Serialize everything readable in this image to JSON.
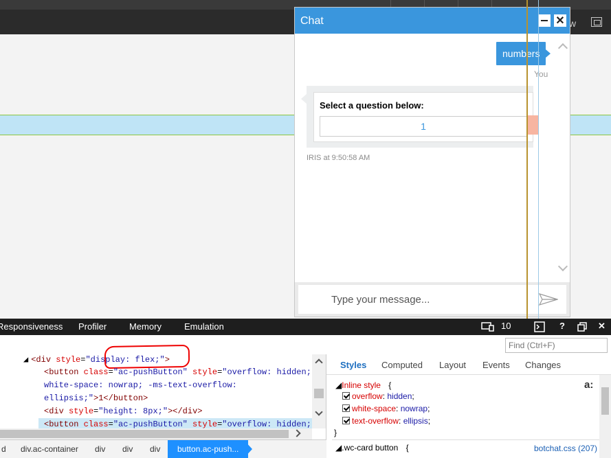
{
  "browser": {
    "toolbar_letter": "w",
    "fit_icon": "fit-to-window-icon"
  },
  "chat": {
    "title": "Chat",
    "minimize_icon": "minimize-icon",
    "close_label": "✕",
    "user_message": "numbers",
    "user_label": "You",
    "card_title": "Select a question below:",
    "card_button": "1",
    "bot_meta": "IRIS at 9:50:58 AM",
    "input_placeholder": "Type your message...",
    "send_icon": "send-icon",
    "colors": {
      "accent": "#3a96dd"
    }
  },
  "devtools": {
    "tabs": [
      "Responsiveness",
      "Profiler",
      "Memory",
      "Emulation"
    ],
    "device_count": "10",
    "help_label": "?",
    "close_label": "✕",
    "find_placeholder": "Find (Ctrl+F)",
    "code_lines": [
      {
        "open": "<div ",
        "attr": "style",
        "eq": "=",
        "val": "\"display: flex;\"",
        "close": ">"
      },
      {
        "open": "<button ",
        "attr": "class",
        "eq": "=",
        "val": "\"ac-pushButton\"",
        "attr2": " style",
        "eq2": "=",
        "val2": "\"overflow: hidden;"
      },
      {
        "text": "white-space: nowrap; -ms-text-overflow:"
      },
      {
        "text": "ellipsis;\"",
        "after": ">1</button>"
      },
      {
        "open": "<div ",
        "attr": "style",
        "eq": "=",
        "val": "\"height: 8px;\"",
        "close": "></div>"
      },
      {
        "open": "<button ",
        "attr": "class",
        "eq": "=",
        "val": "\"ac-pushButton\"",
        "attr2": " style",
        "eq2": "=",
        "val2": "\"overflow: hidden;"
      }
    ],
    "style_tabs": [
      "Styles",
      "Computed",
      "Layout",
      "Events",
      "Changes"
    ],
    "inline_style_label": "Inline style",
    "inline_open": "{",
    "inline_rules": [
      {
        "prop": "overflow",
        "value": "hidden"
      },
      {
        "prop": "white-space",
        "value": "nowrap"
      },
      {
        "prop": "text-overflow",
        "value": "ellipsis"
      }
    ],
    "inline_close": "}",
    "next_selector": ".wc-card button",
    "next_open": "{",
    "next_source": "botchat.css (207)",
    "font_icon_label": "a:",
    "breadcrumbs": [
      "d",
      "div.ac-container",
      "div",
      "div",
      "div",
      "button.ac-push..."
    ]
  }
}
